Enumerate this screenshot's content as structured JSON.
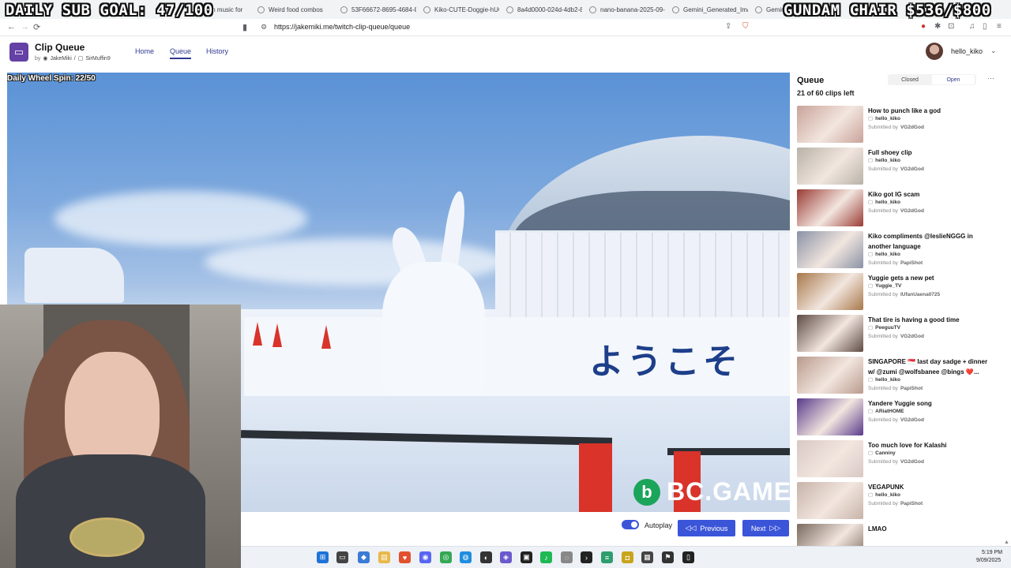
{
  "overlay": {
    "sub_goal": "DAILY SUB GOAL: 47/100",
    "chair_goal": "GUNDAM CHAIR $536/$800"
  },
  "browser": {
    "tabs": [
      {
        "title": "own music for",
        "icon": "music-icon"
      },
      {
        "title": "Weird food combos",
        "icon": "globe-icon"
      },
      {
        "title": "53F66672-8695-4684-8",
        "icon": "globe-icon"
      },
      {
        "title": "Kiko-CUTE-Doggie-hUG",
        "icon": "globe-icon"
      },
      {
        "title": "8a4d0000-024d-4db2-8",
        "icon": "globe-icon"
      },
      {
        "title": "nano-banana-2025-09-0",
        "icon": "globe-icon"
      },
      {
        "title": "Gemini_Generated_Imag",
        "icon": "globe-icon"
      },
      {
        "title": "Gemini",
        "icon": "globe-icon"
      }
    ],
    "url": "https://jakemiki.me/twitch-clip-queue/queue"
  },
  "app": {
    "title": "Clip Queue",
    "by": "by",
    "author1": "JakeMiki",
    "separator": "/",
    "author2": "SirMuffin9",
    "nav": [
      "Home",
      "Queue",
      "History"
    ],
    "user": "hello_kiko"
  },
  "player": {
    "wheel_text": "Daily Wheel Spin: 22/50",
    "jp_sign": "ようこそ",
    "sponsor": "BC.GAME",
    "autoplay_label": "Autoplay",
    "prev_label": "Previous",
    "next_label": "Next"
  },
  "queue": {
    "title": "Queue",
    "count": "21 of 60 clips left",
    "closed_label": "Closed",
    "open_label": "Open",
    "more": "···",
    "submitted_prefix": "Submitted by",
    "clips": [
      {
        "title": "How to punch like a god",
        "channel": "hello_kiko",
        "submitter": "VG2dGod",
        "thumb": "#c9a39a"
      },
      {
        "title": "Full shoey clip",
        "channel": "hello_kiko",
        "submitter": "VG2dGod",
        "thumb": "#b8b2a8"
      },
      {
        "title": "Kiko got IG scam",
        "channel": "hello_kiko",
        "submitter": "VG2dGod",
        "thumb": "#9a3b34"
      },
      {
        "title": "Kiko compliments @leslieNGGG in another language",
        "channel": "hello_kiko",
        "submitter": "PapiShot",
        "thumb": "#8a92a6"
      },
      {
        "title": "Yuggie gets a new pet",
        "channel": "Yuggie_TV",
        "submitter": "IUfanUaena0725",
        "thumb": "#a8784a"
      },
      {
        "title": "That tire is having a good time",
        "channel": "PeeguuTV",
        "submitter": "VG2dGod",
        "thumb": "#5e4a44"
      },
      {
        "title": "SINGAPORE 🇸🇬 last day sadge + dinner w/ @zumi @wolfsbanee @bings ❤️...",
        "channel": "hello_kiko",
        "submitter": "PapiShot",
        "thumb": "#b99a8c"
      },
      {
        "title": "Yandere Yuggie song",
        "channel": "ARiatHOME",
        "submitter": "VG2dGod",
        "thumb": "#5a3a8c"
      },
      {
        "title": "Too much love for Kalashi",
        "channel": "Canniny",
        "submitter": "VG2dGod",
        "thumb": "#d9c8c4"
      },
      {
        "title": "VEGAPUNK",
        "channel": "hello_kiko",
        "submitter": "PapiShot",
        "thumb": "#c7b3a8"
      },
      {
        "title": "LMAO",
        "channel": "",
        "submitter": "",
        "thumb": "#7a6a5e"
      }
    ]
  },
  "taskbar": {
    "time": "5:19 PM",
    "date": "9/09/2025"
  }
}
